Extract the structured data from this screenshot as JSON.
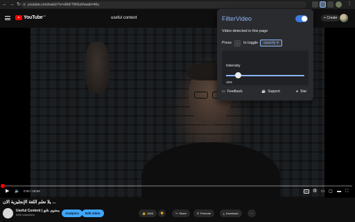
{
  "browser": {
    "url": "youtube.com/watch?v=xRkF7WGoRew&t=40s",
    "nav_icons": [
      "back-icon",
      "forward-icon",
      "reload-icon"
    ]
  },
  "yt_header": {
    "logo": "YouTube",
    "country": "GB",
    "search_text": "useful content",
    "create_label": "Create"
  },
  "player": {
    "time": "0:00 / 18:54",
    "progress_fraction": 0.0
  },
  "video": {
    "title": "يلا نعلم اللغة الإنجليزية الان ...",
    "channel_name": "Useful Content | محتوى نافع",
    "subscribers": "549K subscribers",
    "analytics_label": "Analytics",
    "edit_label": "Edit video",
    "likes": "164K",
    "share_label": "Share",
    "promote_label": "Promote",
    "download_label": "Download"
  },
  "popup": {
    "title": "FilterVideo",
    "enabled": true,
    "detected_text": "Video detected in this page",
    "press_label": "Press",
    "key": ".",
    "toggle_text": "to toggle",
    "mode": "opacity",
    "intensity_label": "Intensity",
    "intensity_value": "15%",
    "intensity_fraction": 0.15,
    "feedback_label": "Feedback",
    "support_label": "Support",
    "star_label": "Star"
  },
  "colors": {
    "accent": "#8ab4f8",
    "toggle_on": "#3b7ae0",
    "yt_red": "#ff0000",
    "yt_blue_button": "#3ea6ff"
  }
}
